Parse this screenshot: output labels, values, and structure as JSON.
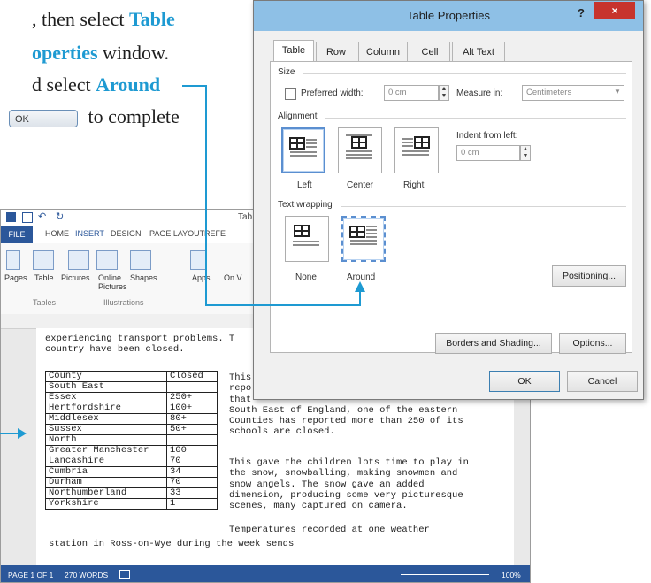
{
  "instructions": {
    "line1_pre": ", then select ",
    "line1_hl": "Table",
    "line2_hl": "operties",
    "line2_post": " window.",
    "line3_pre": "d select ",
    "line3_hl": "Around",
    "line4_button": "OK",
    "line4_post": "to complete"
  },
  "word": {
    "qat_title": "Tab",
    "ribbon_tabs": [
      "FILE",
      "HOME",
      "INSERT",
      "DESIGN",
      "PAGE LAYOUT",
      "REFE"
    ],
    "ribbon_items": [
      "Pages",
      "Table",
      "Pictures",
      "Online Pictures",
      "Shapes",
      "Apps",
      "On V"
    ],
    "group_labels": [
      "Tables",
      "Illustrations"
    ],
    "body_top": "experiencing transport problems. T\ncountry have been closed.",
    "table_header": [
      "County",
      "Closed"
    ],
    "table_rows": [
      [
        "South East",
        ""
      ],
      [
        "Essex",
        "250+"
      ],
      [
        "Hertfordshire",
        "100+"
      ],
      [
        "Middlesex",
        "80+"
      ],
      [
        "Sussex",
        "50+"
      ],
      [
        "North",
        ""
      ],
      [
        "Greater Manchester",
        "100"
      ],
      [
        "Lancashire",
        "70"
      ],
      [
        "Cumbria",
        "34"
      ],
      [
        "Durham",
        "70"
      ],
      [
        "Northumberland",
        "33"
      ],
      [
        "Yorkshire",
        "1"
      ]
    ],
    "side_text_1": "This\nrepo\nthat\nSouth East of England, one of the eastern\nCounties has reported more than 250 of its\nschools are closed.",
    "side_text_2": "This gave the children lots time to play in\nthe snow, snowballing, making snowmen and\nsnow angels. The snow gave an added\ndimension, producing some very picturesque\nscenes, many captured on camera.",
    "side_text_3": "Temperatures recorded at one weather",
    "body_bottom": "station in Ross-on-Wye during the week sends",
    "status_page": "PAGE 1 OF 1",
    "status_words": "270 WORDS",
    "status_zoom": "100%"
  },
  "dialog": {
    "title": "Table Properties",
    "help": "?",
    "close": "×",
    "tabs": [
      "Table",
      "Row",
      "Column",
      "Cell",
      "Alt Text"
    ],
    "size_label": "Size",
    "preferred_width_label": "Preferred width:",
    "preferred_width_value": "0 cm",
    "measure_in_label": "Measure in:",
    "measure_in_value": "Centimeters",
    "alignment_label": "Alignment",
    "indent_label": "Indent from left:",
    "indent_value": "0 cm",
    "align_options": [
      "Left",
      "Center",
      "Right"
    ],
    "wrap_label": "Text wrapping",
    "wrap_options": [
      "None",
      "Around"
    ],
    "positioning_button": "Positioning...",
    "borders_button": "Borders and Shading...",
    "options_button": "Options...",
    "ok_button": "OK",
    "cancel_button": "Cancel"
  },
  "colors": {
    "accent": "#1e9ad2",
    "title_bar": "#8ec0e6",
    "word_blue": "#2b579a"
  }
}
